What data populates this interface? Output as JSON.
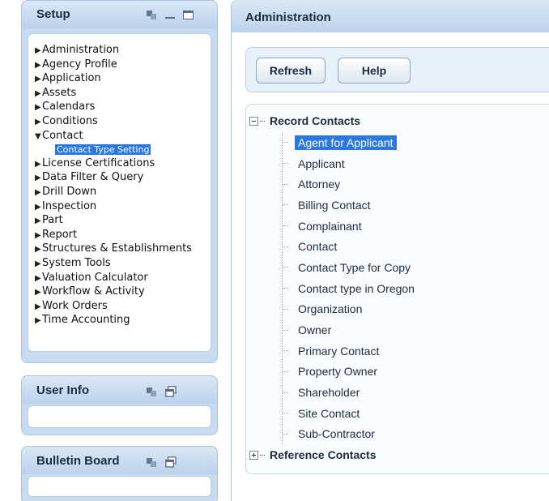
{
  "setup": {
    "title": "Setup",
    "items": [
      {
        "label": "Administration",
        "state": "collapsed"
      },
      {
        "label": "Agency Profile",
        "state": "collapsed"
      },
      {
        "label": "Application",
        "state": "collapsed"
      },
      {
        "label": "Assets",
        "state": "collapsed"
      },
      {
        "label": "Calendars",
        "state": "collapsed"
      },
      {
        "label": "Conditions",
        "state": "collapsed"
      },
      {
        "label": "Contact",
        "state": "expanded"
      },
      {
        "label": "License Certifications",
        "state": "collapsed"
      },
      {
        "label": "Data Filter & Query",
        "state": "collapsed"
      },
      {
        "label": "Drill Down",
        "state": "collapsed"
      },
      {
        "label": "Inspection",
        "state": "collapsed"
      },
      {
        "label": "Part",
        "state": "collapsed"
      },
      {
        "label": "Report",
        "state": "collapsed"
      },
      {
        "label": "Structures & Establishments",
        "state": "collapsed"
      },
      {
        "label": "System Tools",
        "state": "collapsed"
      },
      {
        "label": "Valuation Calculator",
        "state": "collapsed"
      },
      {
        "label": "Workflow & Activity",
        "state": "collapsed"
      },
      {
        "label": "Work Orders",
        "state": "collapsed"
      },
      {
        "label": "Time Accounting",
        "state": "collapsed"
      }
    ],
    "contact_sub_item": "Contact Type Setting"
  },
  "user_info": {
    "title": "User Info"
  },
  "bulletin_board": {
    "title": "Bulletin Board"
  },
  "admin": {
    "title": "Administration",
    "refresh_label": "Refresh",
    "help_label": "Help",
    "record_contacts_label": "Record Contacts",
    "reference_contacts_label": "Reference Contacts",
    "selected_contact": "Agent for Applicant",
    "contact_types": [
      "Agent for Applicant",
      "Applicant",
      "Attorney",
      "Billing Contact",
      "Complainant",
      "Contact",
      "Contact Type for Copy",
      "Contact type in Oregon",
      "Organization",
      "Owner",
      "Primary Contact",
      "Property Owner",
      "Shareholder",
      "Site Contact",
      "Sub-Contractor"
    ]
  },
  "colors": {
    "panel_bg": "#c9dbef",
    "selection": "#2a78e4",
    "text": "#1c2c40"
  }
}
